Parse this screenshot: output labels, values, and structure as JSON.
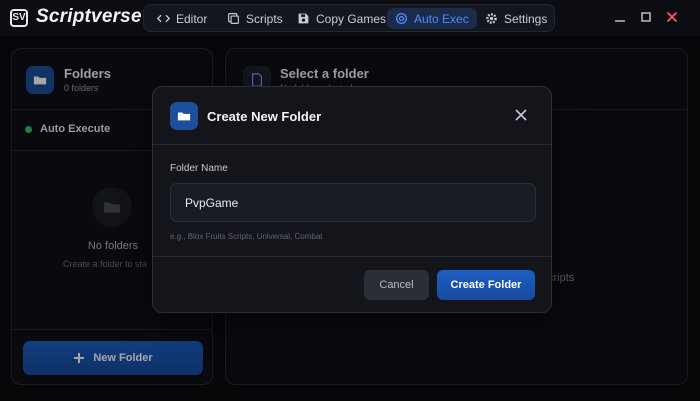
{
  "app": {
    "title": "Scriptverse",
    "logo_text": "SV"
  },
  "nav": {
    "items": [
      {
        "label": "Editor",
        "icon": "code-icon",
        "active": false
      },
      {
        "label": "Scripts",
        "icon": "stack-icon",
        "active": false
      },
      {
        "label": "Copy Games",
        "icon": "save-icon",
        "active": false
      },
      {
        "label": "Auto Exec",
        "icon": "auto-exec-icon",
        "active": true
      },
      {
        "label": "Settings",
        "icon": "gear-icon",
        "active": false
      }
    ]
  },
  "window_controls": [
    "minimize-icon",
    "maximize-icon",
    "close-icon"
  ],
  "left_panel": {
    "title": "Folders",
    "subtitle": "0 folders",
    "auto_execute_label": "Auto Execute",
    "empty_title": "No folders",
    "empty_subtitle": "Create a folder to sta",
    "new_folder_button": "New Folder"
  },
  "right_panel": {
    "title": "Select a folder",
    "subtitle": "No folder selected",
    "empty_text": "cripts"
  },
  "dialog": {
    "title": "Create New Folder",
    "field_label": "Folder Name",
    "field_value": "PvpGame",
    "hint": "e.g., Blox Fruits Scripts, Universal, Combat",
    "cancel_label": "Cancel",
    "create_label": "Create Folder"
  },
  "colors": {
    "accent": "#1e5fc4",
    "active_nav_text": "#4f8bff",
    "status_online": "#35c26b",
    "background": "#0a0b0f"
  }
}
